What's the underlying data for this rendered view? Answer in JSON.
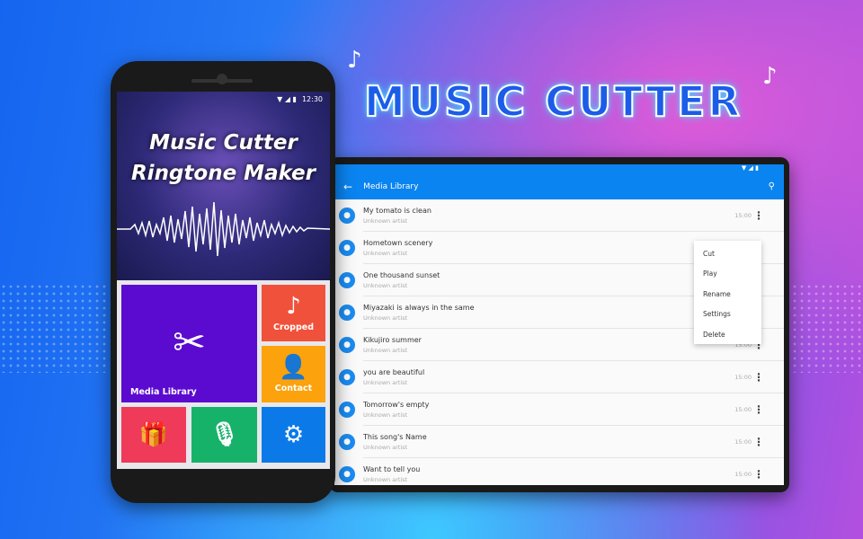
{
  "banner": {
    "title": "MUSIC CUTTER"
  },
  "phone": {
    "status": {
      "time": "12:30"
    },
    "hero": {
      "line1": "Music Cutter",
      "line2": "Ringtone Maker"
    },
    "tiles": [
      {
        "label": "Media Library",
        "icon": "scissors-icon",
        "color": "#5b0bd0"
      },
      {
        "label": "Cropped",
        "icon": "music-note-icon",
        "color": "#f0513a"
      },
      {
        "label": "Contact",
        "icon": "person-icon",
        "color": "#fba20c"
      },
      {
        "label": "",
        "icon": "gift-icon",
        "color": "#ef3a5a"
      },
      {
        "label": "",
        "icon": "microphone-icon",
        "color": "#17b26a"
      },
      {
        "label": "",
        "icon": "gear-icon",
        "color": "#0b7ae8"
      }
    ]
  },
  "tablet": {
    "appbar": {
      "title": "Media Library",
      "accent": "#0a84f0"
    },
    "songs": [
      {
        "title": "My tomato is clean",
        "artist": "Unknown artist",
        "duration": "15:00"
      },
      {
        "title": "Hometown scenery",
        "artist": "Unknown artist",
        "duration": ""
      },
      {
        "title": "One thousand sunset",
        "artist": "Unknown artist",
        "duration": ""
      },
      {
        "title": "Miyazaki is always in the same",
        "artist": "Unknown artist",
        "duration": ""
      },
      {
        "title": "Kikujiro summer",
        "artist": "Unknown artist",
        "duration": "15:00"
      },
      {
        "title": "you are  beautiful",
        "artist": "Unknown artist",
        "duration": "15:00"
      },
      {
        "title": "Tomorrow's empty",
        "artist": "Unknown artist",
        "duration": "15:00"
      },
      {
        "title": "This song's Name",
        "artist": "Unknown artist",
        "duration": "15:00"
      },
      {
        "title": "Want to tell you",
        "artist": "Unknown artist",
        "duration": "15:00"
      }
    ],
    "context_menu": [
      "Cut",
      "Play",
      "Rename",
      "Settings",
      "Delete"
    ]
  }
}
